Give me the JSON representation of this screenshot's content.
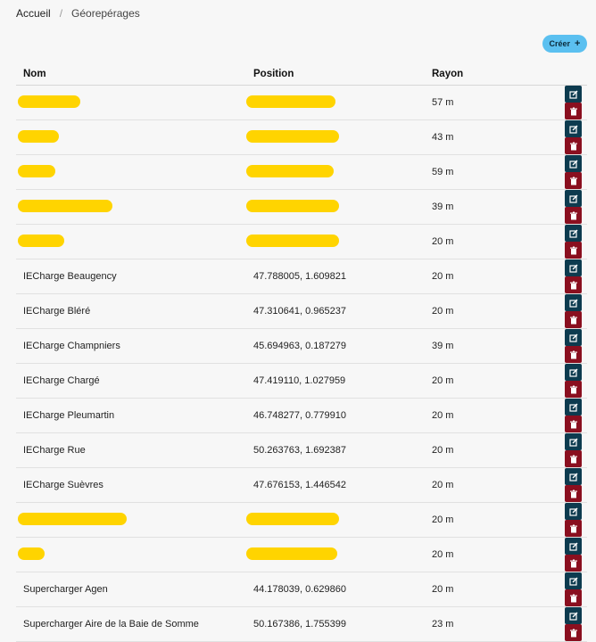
{
  "breadcrumb": {
    "home": "Accueil",
    "separator": "/",
    "current": "Géorepérages"
  },
  "toolbar": {
    "create_label": "Créer",
    "create_icon": "+"
  },
  "table": {
    "headers": {
      "name": "Nom",
      "position": "Position",
      "rayon": "Rayon"
    },
    "rows": [
      {
        "name": "",
        "position": "",
        "rayon": "57 m",
        "redacted": true
      },
      {
        "name": "",
        "position": "",
        "rayon": "43 m",
        "redacted": true
      },
      {
        "name": "",
        "position": "",
        "rayon": "59 m",
        "redacted": true
      },
      {
        "name": "",
        "position": "",
        "rayon": "39 m",
        "redacted": true
      },
      {
        "name": "",
        "position": "",
        "rayon": "20 m",
        "redacted": true
      },
      {
        "name": "IECharge Beaugency",
        "position": "47.788005, 1.609821",
        "rayon": "20 m"
      },
      {
        "name": "IECharge Bléré",
        "position": "47.310641, 0.965237",
        "rayon": "20 m"
      },
      {
        "name": "IECharge Champniers",
        "position": "45.694963, 0.187279",
        "rayon": "39 m"
      },
      {
        "name": "IECharge Chargé",
        "position": "47.419110, 1.027959",
        "rayon": "20 m"
      },
      {
        "name": "IECharge Pleumartin",
        "position": "46.748277, 0.779910",
        "rayon": "20 m"
      },
      {
        "name": "IECharge Rue",
        "position": "50.263763, 1.692387",
        "rayon": "20 m"
      },
      {
        "name": "IECharge Suèvres",
        "position": "47.676153, 1.446542",
        "rayon": "20 m"
      },
      {
        "name": "",
        "position": "",
        "rayon": "20 m",
        "redacted": true
      },
      {
        "name": "",
        "position": "",
        "rayon": "20 m",
        "redacted": true
      },
      {
        "name": "Supercharger Agen",
        "position": "44.178039, 0.629860",
        "rayon": "20 m"
      },
      {
        "name": "Supercharger Aire de la Baie de Somme",
        "position": "50.167386, 1.755399",
        "rayon": "23 m"
      }
    ]
  },
  "icons": {
    "edit": "edit-icon",
    "delete": "trash-icon"
  },
  "colors": {
    "create_button": "#5bc0f0",
    "edit_button": "#0d3b4f",
    "delete_button": "#8a0f1f",
    "redaction": "#ffd400"
  }
}
